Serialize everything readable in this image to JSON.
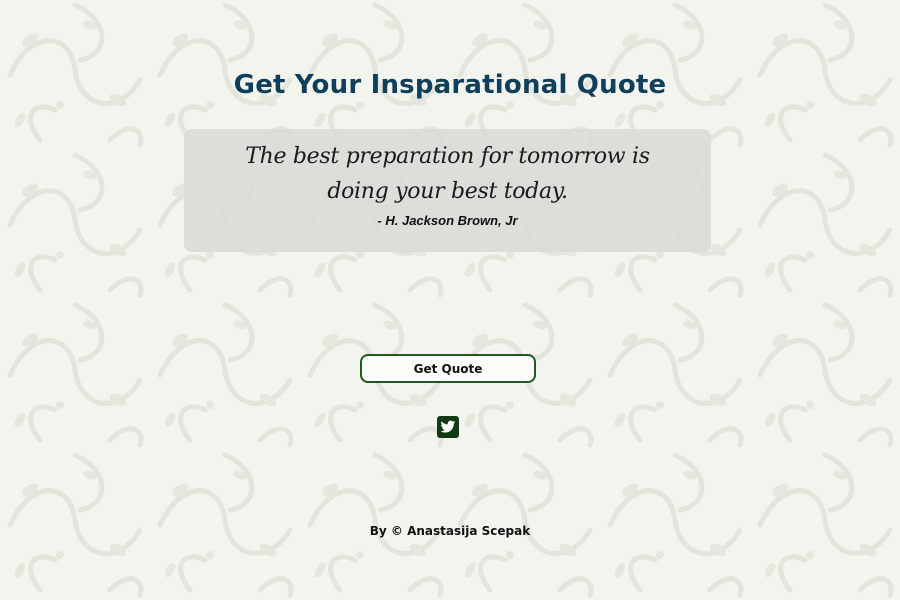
{
  "header": {
    "title": "Get Your Insparational Quote"
  },
  "quote": {
    "text": "The best preparation for tomorrow is doing your best today.",
    "author": "- H. Jackson Brown, Jr"
  },
  "actions": {
    "get_quote_label": "Get Quote",
    "twitter_icon": "twitter-icon"
  },
  "footer": {
    "credit": "By © Anastasija Scepak"
  },
  "colors": {
    "title": "#0f3f5a",
    "button_border": "#1f5a22",
    "twitter_bg": "#123a14",
    "background": "#f4f4ef",
    "quote_box": "#dadad6"
  }
}
